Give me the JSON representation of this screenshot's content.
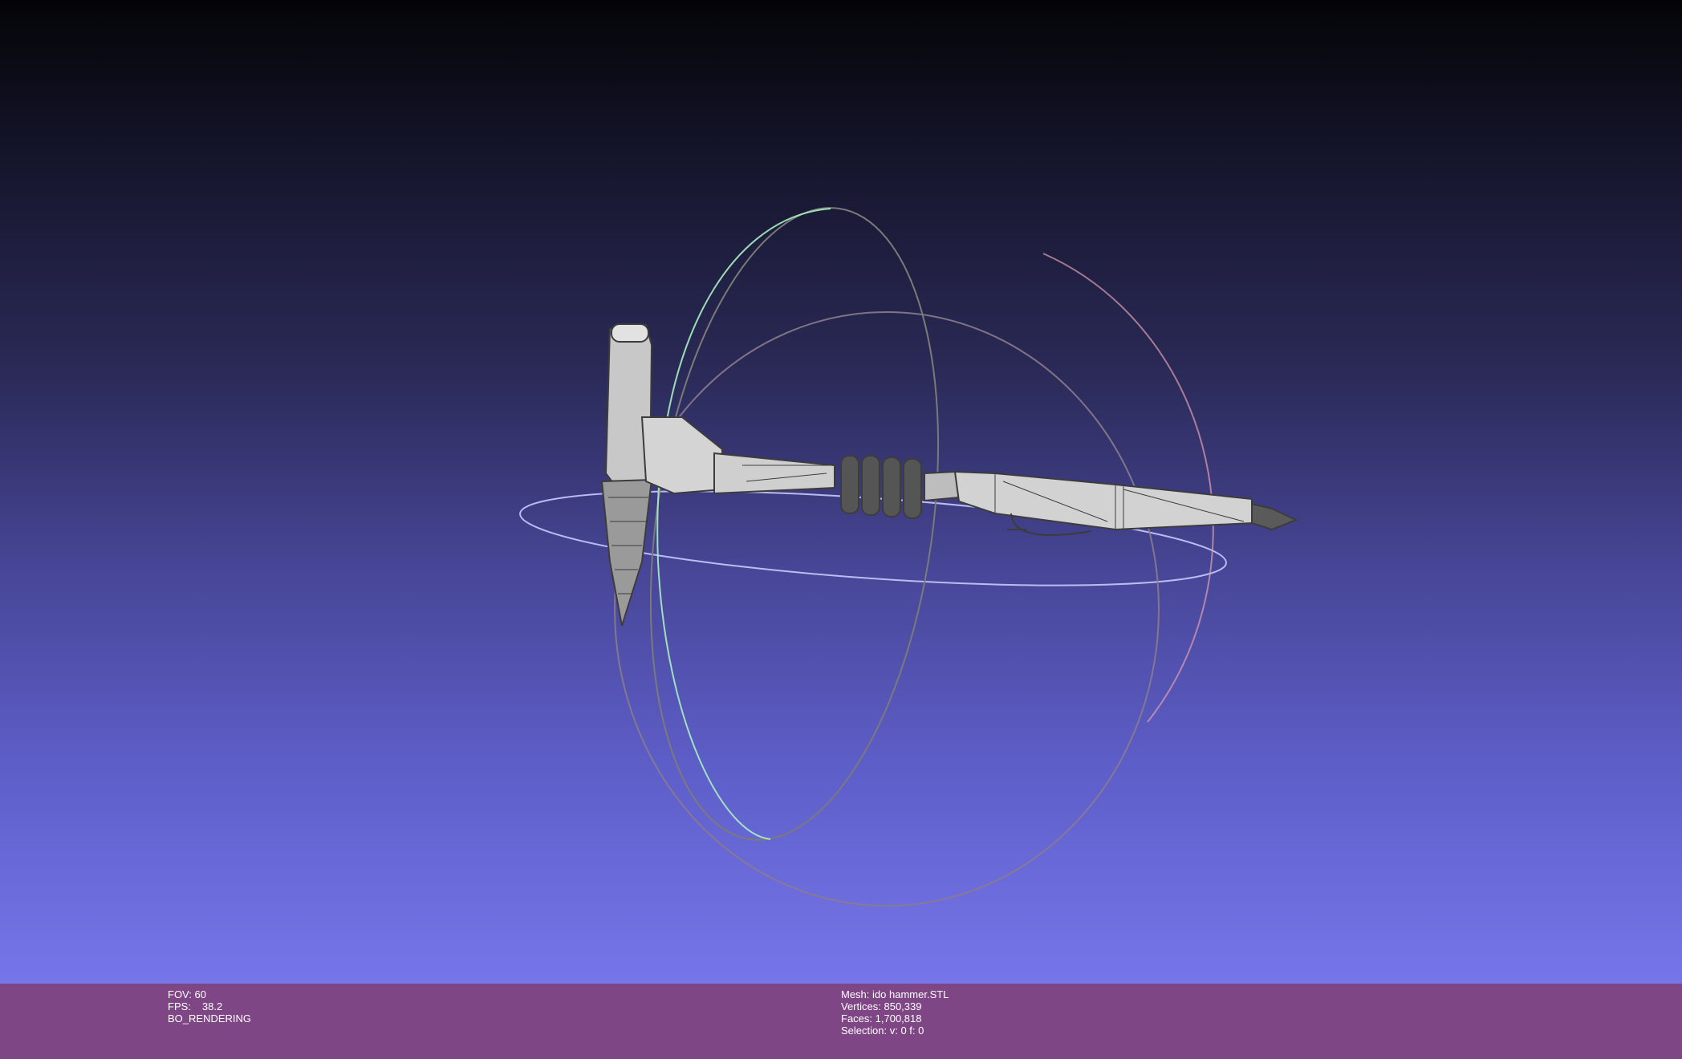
{
  "viewport": {
    "mesh_color": "#4a4a4a",
    "mesh_fill": "#d6d6d6",
    "trackball_colors": {
      "horizontal": "#c9c9ff",
      "vertical_green": "#a9f0c0",
      "vertical_red": "#e0a0b0",
      "gray": "#808080"
    }
  },
  "info_left": {
    "fov_label": "FOV:",
    "fov_value": "60",
    "fps_label": "FPS:",
    "fps_value": "38.2",
    "render_mode": "BO_RENDERING"
  },
  "info_right": {
    "mesh_label": "Mesh:",
    "mesh_value": "ido hammer.STL",
    "vertices_label": "Vertices:",
    "vertices_value": "850,339",
    "faces_label": "Faces:",
    "faces_value": "1,700,818",
    "selection_label": "Selection:",
    "selection_value": "v: 0 f: 0"
  }
}
